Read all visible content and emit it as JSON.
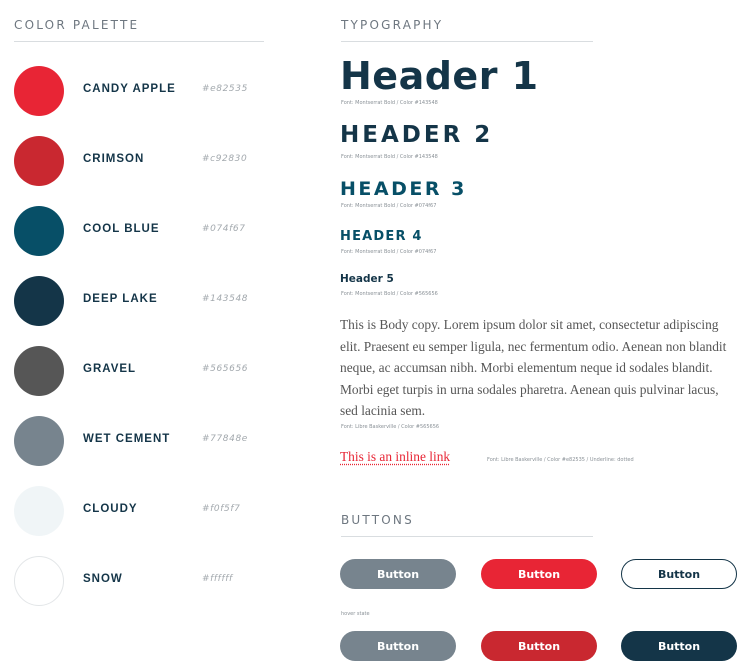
{
  "palette": {
    "title": "COLOR PALETTE",
    "swatches": [
      {
        "name": "CANDY APPLE",
        "hex": "#e82535",
        "color": "#e82535"
      },
      {
        "name": "CRIMSON",
        "hex": "#c92830",
        "color": "#c92830"
      },
      {
        "name": "COOL BLUE",
        "hex": "#074f67",
        "color": "#074f67"
      },
      {
        "name": "DEEP LAKE",
        "hex": "#143548",
        "color": "#143548"
      },
      {
        "name": "GRAVEL",
        "hex": "#565656",
        "color": "#565656"
      },
      {
        "name": "WET CEMENT",
        "hex": "#77848e",
        "color": "#77848e"
      },
      {
        "name": "CLOUDY",
        "hex": "#f0f5f7",
        "color": "#f0f5f7"
      },
      {
        "name": "SNOW",
        "hex": "#ffffff",
        "color": "#ffffff"
      }
    ]
  },
  "typography": {
    "title": "TYPOGRAPHY",
    "h1": "Header 1",
    "h1_caption": "Font: Montserrat Bold / Color #143548",
    "h2": "HEADER 2",
    "h2_caption": "Font: Montserrat Bold / Color #143548",
    "h3": "HEADER 3",
    "h3_caption": "Font: Montserrat Bold / Color #074f67",
    "h4": "HEADER 4",
    "h4_caption": "Font: Montserrat Bold / Color #074f67",
    "h5": "Header 5",
    "h5_caption": "Font: Montserrat Bold / Color #565656",
    "body": "This is Body copy. Lorem ipsum dolor sit amet, consectetur adipiscing elit. Praesent eu semper ligula, nec fermentum odio. Aenean non blandit neque, ac accumsan nibh. Morbi elementum neque id sodales blandit. Morbi eget turpis in urna sodales pharetra. Aenean quis pulvinar lacus, sed lacinia sem.",
    "body_caption": "Font: Libre Baskerville / Color #565656",
    "link": "This is an inline link",
    "link_caption": "Font: Libre Baskerville / Color #e82535 / Underline: dotted"
  },
  "buttons": {
    "title": "BUTTONS",
    "default_row": [
      "Button",
      "Button",
      "Button"
    ],
    "hover_label": "hover state",
    "hover_row": [
      "Button",
      "Button",
      "Button"
    ]
  }
}
